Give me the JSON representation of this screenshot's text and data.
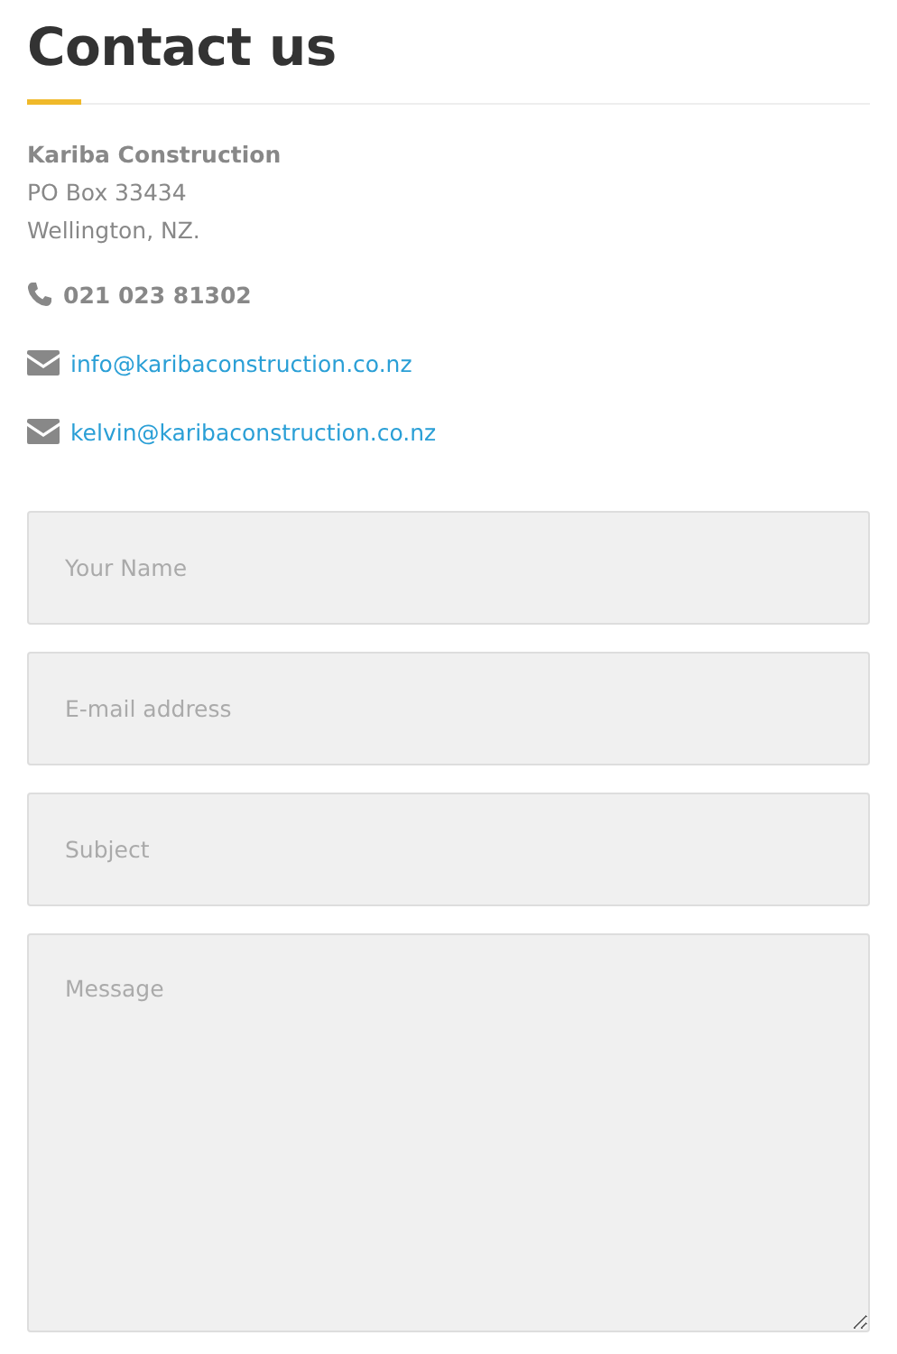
{
  "heading": "Contact us",
  "address": {
    "company": "Kariba Construction",
    "lines": [
      "PO Box 33434",
      "Wellington, NZ."
    ]
  },
  "contacts": [
    {
      "kind": "phone",
      "text": "021 023 81302"
    },
    {
      "kind": "email",
      "text": "info@karibaconstruction.co.nz"
    },
    {
      "kind": "email",
      "text": "kelvin@karibaconstruction.co.nz"
    }
  ],
  "form": {
    "fields": [
      {
        "kind": "input",
        "placeholder": "Your Name"
      },
      {
        "kind": "input",
        "placeholder": "E-mail address"
      },
      {
        "kind": "input",
        "placeholder": "Subject"
      },
      {
        "kind": "textarea",
        "placeholder": "Message"
      }
    ]
  }
}
